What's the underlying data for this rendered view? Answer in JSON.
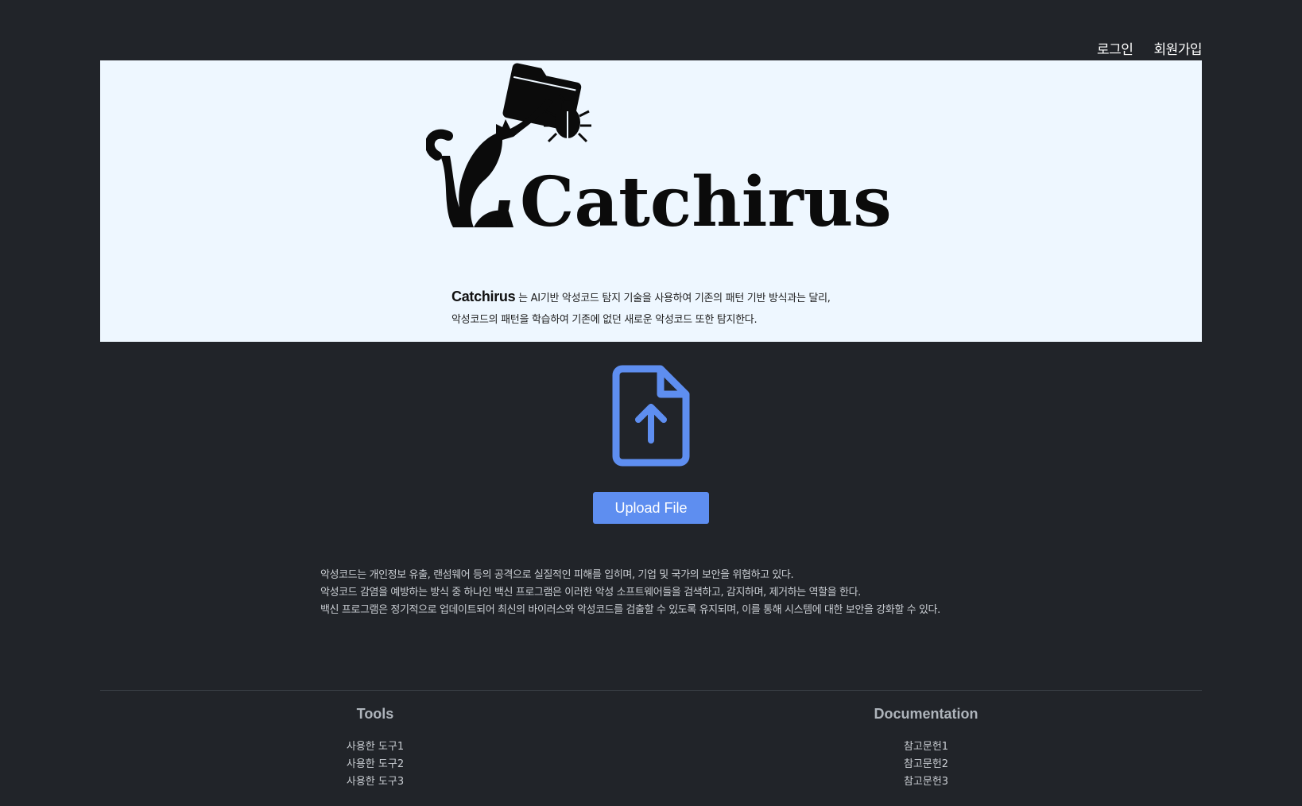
{
  "nav": {
    "login": "로그인",
    "signup": "회원가입"
  },
  "hero": {
    "logo_text": "Catchirus",
    "brand": "Catchirus",
    "desc_line1_rest": " 는 AI기반 악성코드 탐지 기술을 사용하여 기존의 패턴 기반 방식과는 달리,",
    "desc_line2": "악성코드의 패턴을 학습하여 기존에 없던 새로운 악성코드 또한 탐지한다."
  },
  "upload": {
    "icon": "file-upload-icon",
    "button_label": "Upload File"
  },
  "info": {
    "line1": "악성코드는 개인정보 유출, 랜섬웨어 등의 공격으로 실질적인 피해를 입히며, 기업 및 국가의 보안을 위협하고 있다.",
    "line2": "악성코드 감염을 예방하는 방식 중 하나인 백신 프로그램은 이러한 악성 소프트웨어들을 검색하고, 감지하며, 제거하는 역할을 한다.",
    "line3": "백신 프로그램은 정기적으로 업데이트되어 최신의 바이러스와 악성코드를 검출할 수 있도록 유지되며, 이를 통해 시스템에 대한 보안을 강화할 수 있다."
  },
  "footer": {
    "tools": {
      "title": "Tools",
      "items": [
        "사용한 도구1",
        "사용한 도구2",
        "사용한 도구3"
      ]
    },
    "docs": {
      "title": "Documentation",
      "items": [
        "참고문헌1",
        "참고문헌2",
        "참고문헌3"
      ]
    }
  },
  "colors": {
    "background": "#212429",
    "hero_bg": "#eef7ff",
    "accent": "#5e8ef0"
  }
}
